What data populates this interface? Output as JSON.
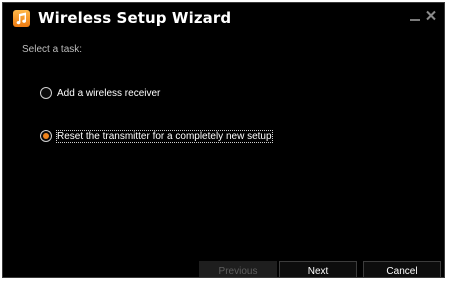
{
  "window": {
    "title": "Wireless Setup Wizard",
    "app_icon": "music-note-icon",
    "accent_color": "#f0841c",
    "controls": [
      "minimize-icon",
      "close-icon"
    ]
  },
  "content": {
    "task_label": "Select a task:",
    "options": [
      {
        "label": "Add a wireless receiver",
        "selected": false
      },
      {
        "label": "Reset the transmitter for a completely new setup",
        "selected": true
      }
    ]
  },
  "buttons": {
    "previous": {
      "label": "Previous",
      "enabled": false
    },
    "next": {
      "label": "Next",
      "enabled": true
    },
    "cancel": {
      "label": "Cancel",
      "enabled": true
    }
  }
}
